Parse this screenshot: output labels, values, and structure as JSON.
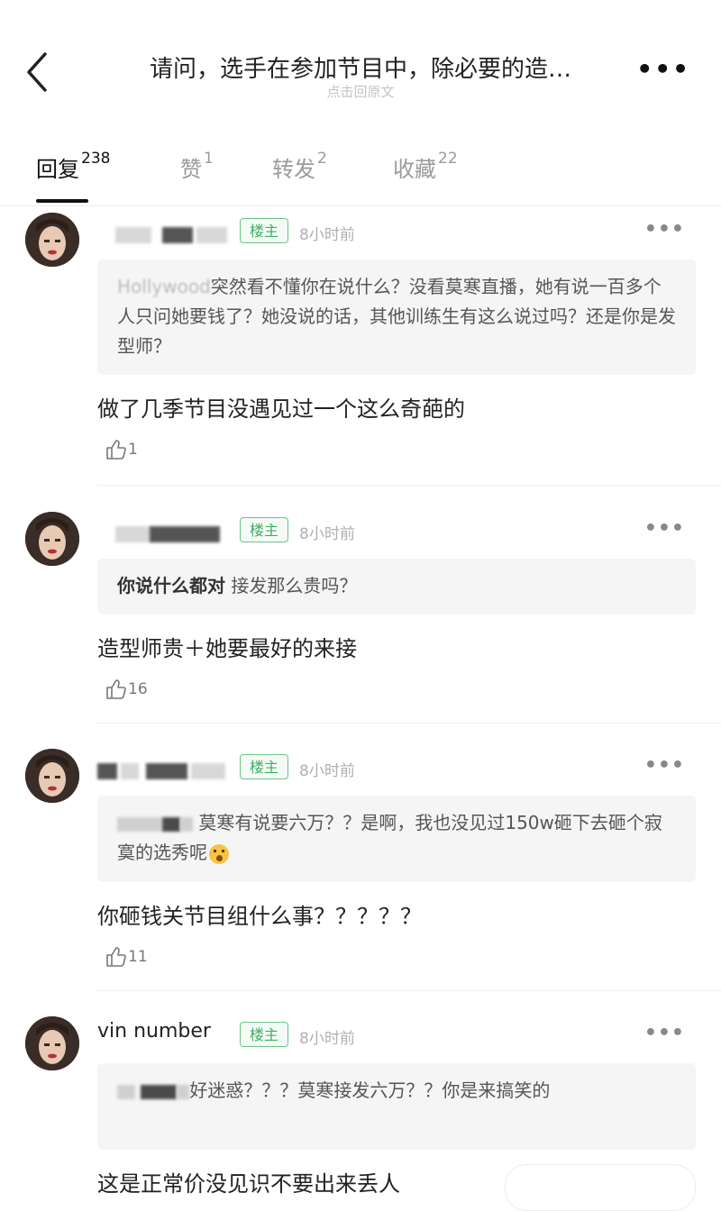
{
  "header": {
    "title": "请问，选手在参加节目中，除必要的造…",
    "subtitle": "点击回原文",
    "more_label": "•••"
  },
  "tabs": [
    {
      "label": "回复",
      "count": "238",
      "active": true
    },
    {
      "label": "赞",
      "count": "1",
      "active": false
    },
    {
      "label": "转发",
      "count": "2",
      "active": false
    },
    {
      "label": "收藏",
      "count": "22",
      "active": false
    }
  ],
  "comments": [
    {
      "badge": "楼主",
      "time": "8小时前",
      "more": "•••",
      "quote_prefix": "Hollywood",
      "quote_text": "突然看不懂你在说什么？没看莫寒直播，她有说一百多个人只问她要钱了？她没说的话，其他训练生有这么说过吗？还是你是发型师？",
      "body": "做了几季节目没遇见过一个这么奇葩的",
      "likes": "1"
    },
    {
      "badge": "楼主",
      "time": "8小时前",
      "more": "•••",
      "quote_name": "你说什么都对",
      "quote_text": " 接发那么贵吗？",
      "body": "造型师贵＋她要最好的来接",
      "likes": "16"
    },
    {
      "badge": "楼主",
      "time": "8小时前",
      "more": "•••",
      "quote_text": "莫寒有说要六万？？是啊，我也没见过150w砸下去砸个寂寞的选秀呢",
      "body": "你砸钱关节目组什么事？？？？？",
      "likes": "11"
    },
    {
      "username": "vin number",
      "badge": "楼主",
      "time": "8小时前",
      "more": "•••",
      "quote_text": "好迷惑？？？莫寒接发六万？？你是来搞笑的",
      "body": "这是正常价没见识不要出来丢人"
    }
  ],
  "colors": {
    "accent_green": "#3fae61",
    "text_primary": "#222222",
    "text_muted": "#b0b0b0",
    "quote_bg": "#f5f5f5"
  },
  "icons": {
    "back": "chevron-left-icon",
    "more": "more-dots-icon",
    "like": "thumbs-up-icon"
  }
}
